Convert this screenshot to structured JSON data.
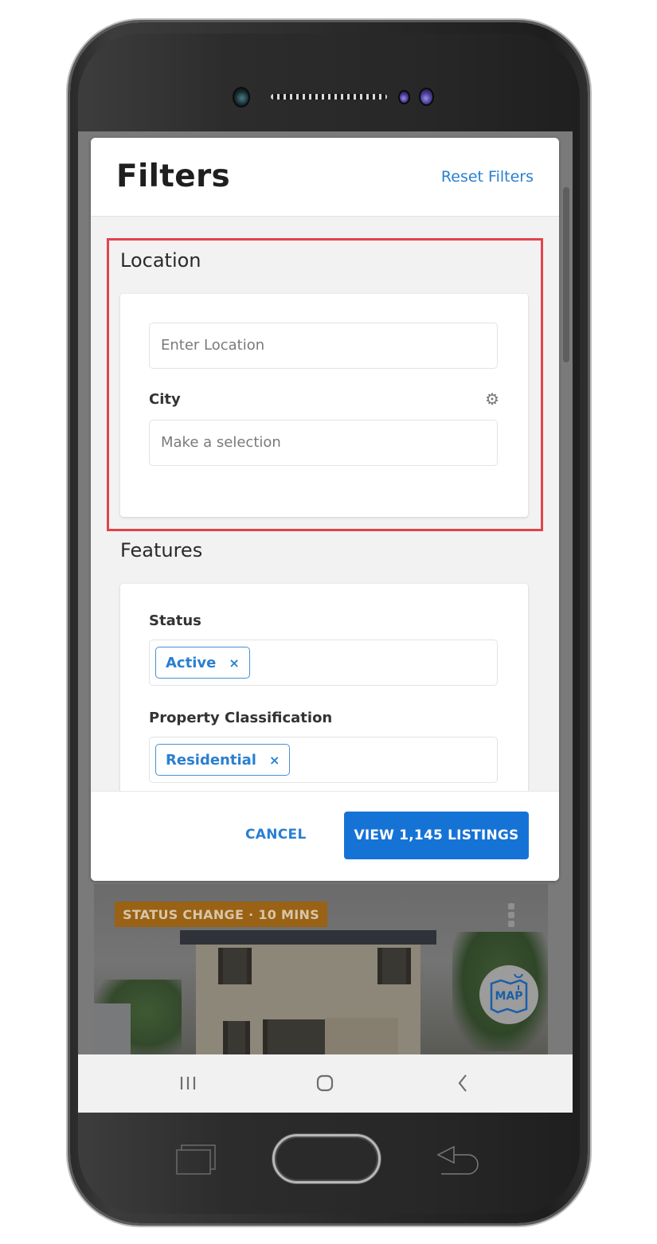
{
  "modal": {
    "title": "Filters",
    "reset_label": "Reset Filters"
  },
  "location": {
    "title": "Location",
    "location_input": {
      "placeholder": "Enter Location",
      "value": ""
    },
    "city": {
      "label": "City",
      "icon": "gear-icon",
      "placeholder": "Make a selection",
      "value": ""
    }
  },
  "features": {
    "title": "Features",
    "status": {
      "label": "Status",
      "chips": [
        {
          "label": "Active",
          "remove_glyph": "×"
        }
      ]
    },
    "property_classification": {
      "label": "Property Classification",
      "chips": [
        {
          "label": "Residential",
          "remove_glyph": "×"
        }
      ]
    }
  },
  "footer": {
    "cancel_label": "CANCEL",
    "view_label": "VIEW 1,145 LISTINGS",
    "listing_count": 1145
  },
  "listing_card": {
    "badge": "STATUS CHANGE · 10 MINS",
    "map_label": "MAP"
  },
  "navbar": {
    "items": [
      {
        "name": "recent-apps",
        "glyph": "|||"
      },
      {
        "name": "home",
        "glyph": "▢"
      },
      {
        "name": "back",
        "glyph": "‹"
      }
    ]
  },
  "colors": {
    "accent": "#1673d6",
    "link": "#2a7fd1",
    "highlight": "#e2434b",
    "badge": "#996215"
  }
}
